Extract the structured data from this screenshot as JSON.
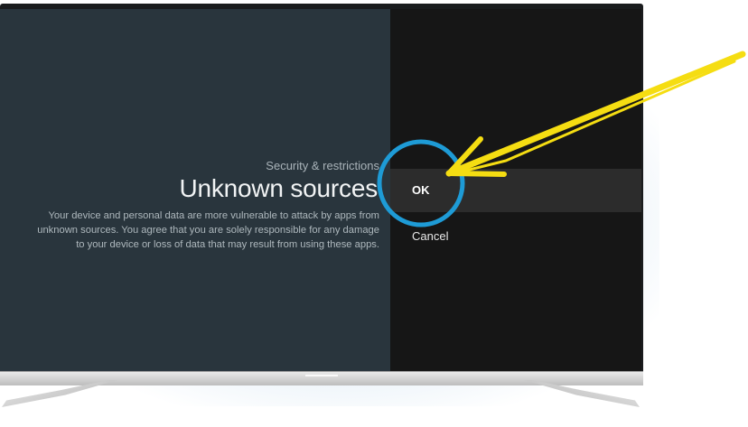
{
  "screen": {
    "breadcrumb": "Security & restrictions",
    "title": "Unknown sources",
    "description": "Your device and personal data are more vulnerable to attack by apps from unknown sources. You agree that you are solely responsible for any damage to your device or loss of data that may result from using these apps."
  },
  "actions": {
    "ok_label": "OK",
    "cancel_label": "Cancel"
  },
  "colors": {
    "left_panel": "#29353d",
    "right_panel": "#161616",
    "highlight_circle": "#1e9bd6",
    "arrow": "#f5dd12"
  },
  "annotations": {
    "circle_target": "ok-button",
    "arrow_target": "ok-button"
  }
}
